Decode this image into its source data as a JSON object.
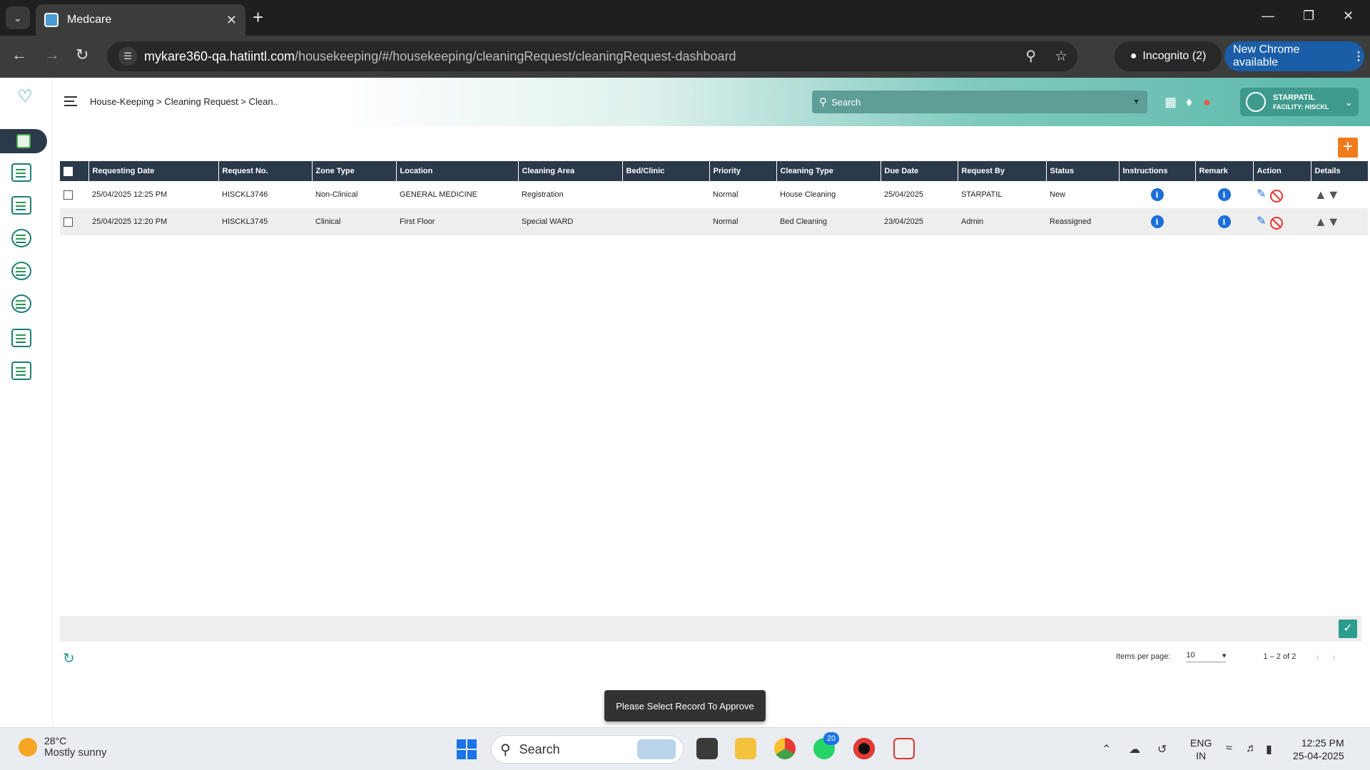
{
  "browser": {
    "tab_title": "Medcare",
    "url_domain": "mykare360-qa.hatiintl.com",
    "url_path": "/housekeeping/#/housekeeping/cleaningRequest/cleaningRequest-dashboard",
    "incognito_label": "Incognito (2)",
    "update_label": "New Chrome available"
  },
  "app": {
    "breadcrumb": "House-Keeping > Cleaning Request > Clean..",
    "search_placeholder": "Search",
    "user_name": "STARPATIL",
    "facility": "FACILITY: HISCKL",
    "accent_color": "#2a9d8f",
    "header_color": "#2b3a4a"
  },
  "table": {
    "columns": [
      "Requesting Date",
      "Request No.",
      "Zone Type",
      "Location",
      "Cleaning Area",
      "Bed/Clinic",
      "Priority",
      "Cleaning Type",
      "Due Date",
      "Request By",
      "Status",
      "Instructions",
      "Remark",
      "Action",
      "Details"
    ],
    "rows": [
      {
        "requesting_date": "25/04/2025 12:25 PM",
        "request_no": "HISCKL3746",
        "zone_type": "Non-Clinical",
        "location": "GENERAL MEDICINE",
        "cleaning_area": "Registration",
        "bed_clinic": "",
        "priority": "Normal",
        "cleaning_type": "House Cleaning",
        "due_date": "25/04/2025",
        "request_by": "STARPATIL",
        "status": "New"
      },
      {
        "requesting_date": "25/04/2025 12:20 PM",
        "request_no": "HISCKL3745",
        "zone_type": "Clinical",
        "location": "First Floor",
        "cleaning_area": "Special WARD",
        "bed_clinic": "",
        "priority": "Normal",
        "cleaning_type": "Bed Cleaning",
        "due_date": "23/04/2025",
        "request_by": "Admin",
        "status": "Reassigned"
      }
    ]
  },
  "paginator": {
    "items_per_page_label": "Items per page:",
    "items_per_page": "10",
    "range": "1 – 2 of 2"
  },
  "snackbar": "Please Select Record To Approve",
  "taskbar": {
    "temperature": "28°C",
    "weather": "Mostly sunny",
    "search": "Search",
    "whatsapp_badge": "20",
    "lang_top": "ENG",
    "lang_bottom": "IN",
    "time": "12:25 PM",
    "date": "25-04-2025"
  }
}
